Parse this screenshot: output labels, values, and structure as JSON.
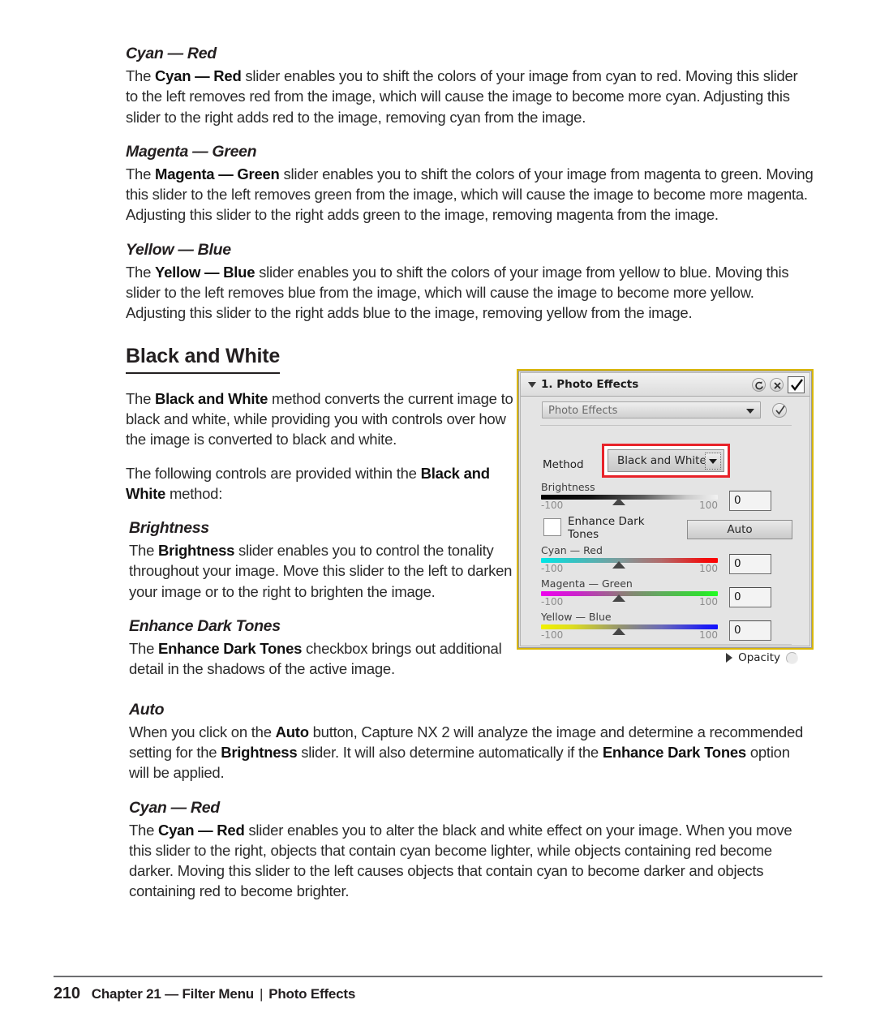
{
  "sections": [
    {
      "id": "cyan_red_top",
      "heading": "Cyan — Red",
      "paragraph_html": "The <b>Cyan — Red</b> slider enables you to shift the colors of your image from cyan to red. Moving this slider to the left removes red from the image, which will cause the image to become more cyan. Adjusting this slider to the right adds red to the image, removing cyan from the image."
    },
    {
      "id": "magenta_green",
      "heading": "Magenta — Green",
      "paragraph_html": "The <b>Magenta — Green</b> slider enables you to shift the colors of your image from magenta to green. Moving this slider to the left removes green from the image, which will cause the image to become more magenta. Adjusting this slider to the right adds green to the image, removing magenta from the image."
    },
    {
      "id": "yellow_blue",
      "heading": "Yellow — Blue",
      "paragraph_html": "The <b>Yellow — Blue</b> slider enables you to shift the colors of your image from yellow to blue. Moving this slider to the left removes blue from the image, which will cause the image to become more yellow. Adjusting this slider to the right adds blue to the image, removing yellow from the image."
    }
  ],
  "black_and_white": {
    "heading": "Black and White",
    "intro_html": "The <b>Black and White</b> method converts the current image to black and white, while providing you with controls over how the image is converted to black and white.",
    "intro2_html": "The following controls are provided within the <b>Black and White</b> method:",
    "subsections": [
      {
        "id": "brightness",
        "heading": "Brightness",
        "narrow": true,
        "paragraph_html": "The <b>Brightness</b> slider enables you to control the tonality throughout your image. Move this slider to the left to darken your image or to the right to brighten the image."
      },
      {
        "id": "enhance_dark_tones",
        "heading": "Enhance Dark Tones",
        "narrow": true,
        "paragraph_html": "The <b>Enhance Dark Tones</b> checkbox brings out additional detail in the shadows of the active image."
      },
      {
        "id": "auto",
        "heading": "Auto",
        "narrow": false,
        "paragraph_html": "When you click on the <b>Auto</b> button, Capture NX 2 will analyze the image and determine a recommended setting for the <b>Brightness</b> slider. It will also determine automatically if the <b>Enhance Dark Tones</b> option will be applied."
      },
      {
        "id": "cyan_red_bw",
        "heading": "Cyan — Red",
        "narrow": false,
        "paragraph_html": "The <b>Cyan — Red</b> slider enables you to alter the black and white effect on your image. When you move this slider to the right, objects that contain cyan become lighter, while objects containing red become darker. Moving this slider to the left causes objects that contain cyan to become darker and objects containing red to become brighter."
      }
    ]
  },
  "screenshot_panel": {
    "title": "1. Photo Effects",
    "title_icons": [
      "reset-icon",
      "close-icon",
      "enable-checkbox"
    ],
    "effect_combo": {
      "value": "Photo Effects",
      "arrow_icon": "chevron-down-icon",
      "apply_icon": "apply-check-icon"
    },
    "method": {
      "label": "Method",
      "value": "Black and White",
      "arrow_icon": "chevron-down-icon",
      "callout_color": "#e8232a"
    },
    "sliders": [
      {
        "name": "Brightness",
        "min": "-100",
        "max": "100",
        "value": "0",
        "thumb_pct": 44,
        "gradient_class": "g-bright"
      },
      {
        "name": "Cyan — Red",
        "min": "-100",
        "max": "100",
        "value": "0",
        "thumb_pct": 44,
        "gradient_class": "g-cyan"
      },
      {
        "name": "Magenta — Green",
        "min": "-100",
        "max": "100",
        "value": "0",
        "thumb_pct": 44,
        "gradient_class": "g-mag"
      },
      {
        "name": "Yellow — Blue",
        "min": "-100",
        "max": "100",
        "value": "0",
        "thumb_pct": 44,
        "gradient_class": "g-yel"
      }
    ],
    "enhance_dark_tones": {
      "label": "Enhance Dark Tones",
      "checked": false
    },
    "auto_button": "Auto",
    "opacity": {
      "label": "Opacity",
      "expand_icon": "triangle-right-icon",
      "knob_icon": "opacity-knob-icon"
    },
    "border_color": "#d9b600"
  },
  "footer": {
    "page_number": "210",
    "chapter": "Chapter 21 — Filter Menu",
    "separator": "|",
    "topic": "Photo Effects"
  }
}
